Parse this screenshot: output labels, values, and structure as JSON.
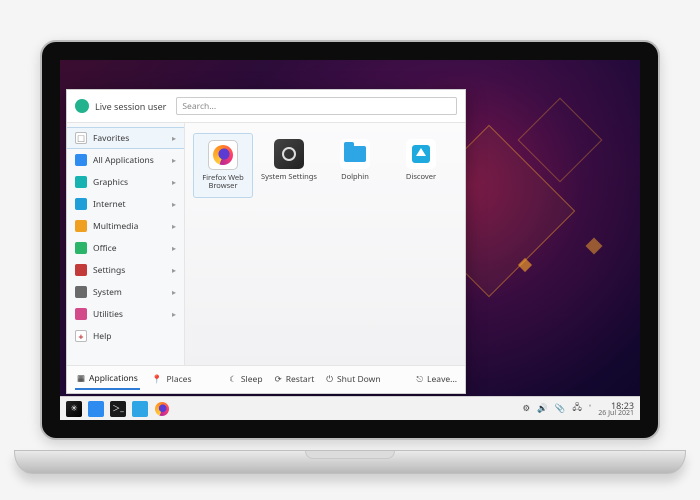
{
  "user": {
    "name": "Live session user"
  },
  "search": {
    "placeholder": "Search..."
  },
  "sidebar": {
    "items": [
      {
        "label": "Favorites"
      },
      {
        "label": "All Applications"
      },
      {
        "label": "Graphics"
      },
      {
        "label": "Internet"
      },
      {
        "label": "Multimedia"
      },
      {
        "label": "Office"
      },
      {
        "label": "Settings"
      },
      {
        "label": "System"
      },
      {
        "label": "Utilities"
      },
      {
        "label": "Help"
      }
    ]
  },
  "apps": {
    "firefox": "Firefox Web Browser",
    "system_settings": "System Settings",
    "dolphin": "Dolphin",
    "discover": "Discover"
  },
  "footer": {
    "tab_applications": "Applications",
    "tab_places": "Places",
    "sleep": "Sleep",
    "restart": "Restart",
    "shutdown": "Shut Down",
    "leave": "Leave..."
  },
  "tray": {
    "time": "18:23",
    "date": "26 Jul 2021"
  }
}
